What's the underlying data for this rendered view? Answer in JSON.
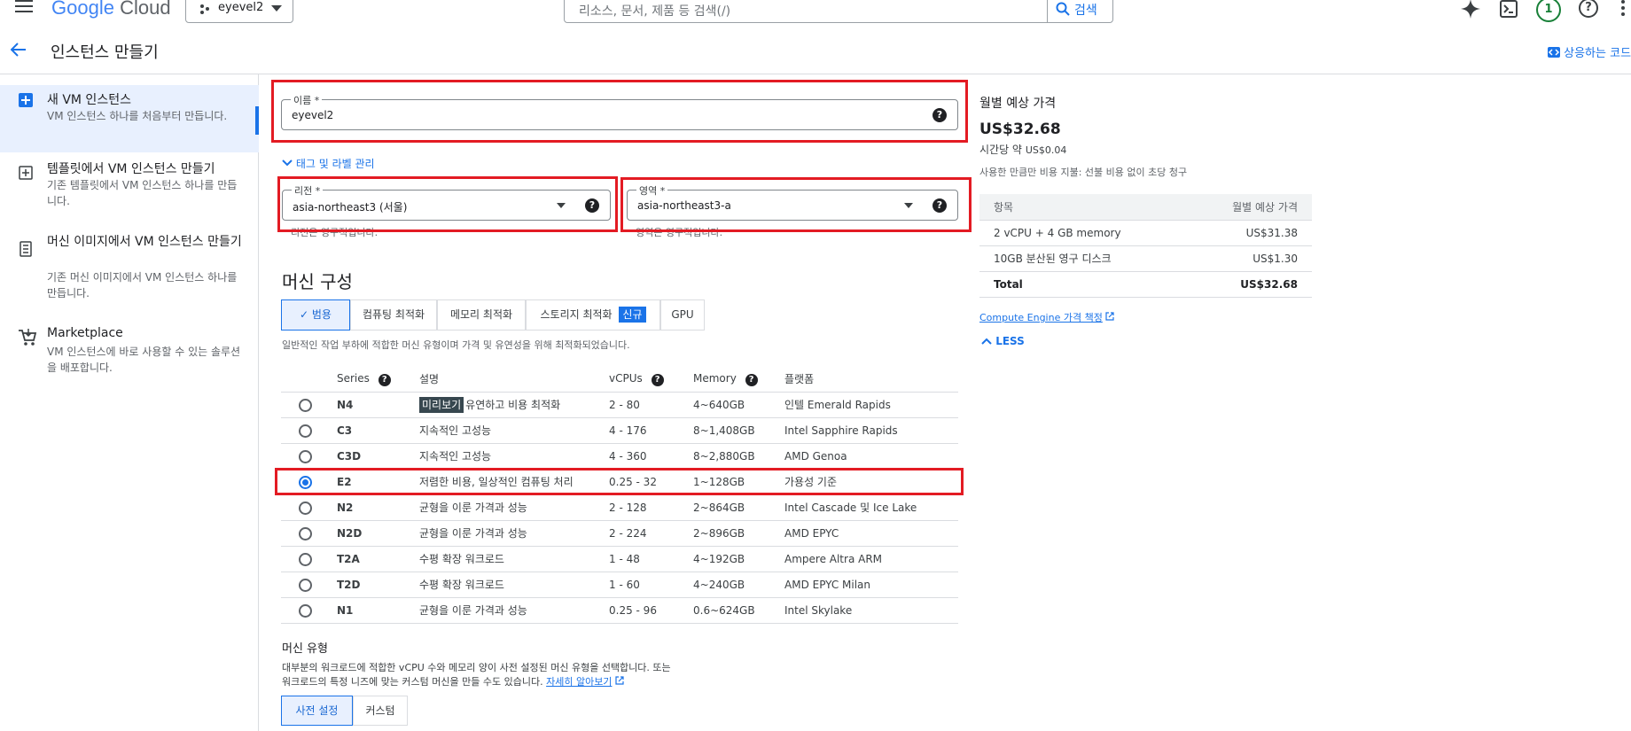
{
  "topbar": {
    "logo_google": "Google",
    "logo_cloud": "Cloud",
    "project": "eyevel2",
    "search_placeholder": "리소스, 문서, 제품 등 검색(/)",
    "search_button": "검색",
    "notification_count": "1"
  },
  "header": {
    "title": "인스턴스 만들기",
    "equivalent_code": "상응하는 코드"
  },
  "sidebar": {
    "items": [
      {
        "title": "새 VM 인스턴스",
        "desc": "VM 인스턴스 하나를 처음부터 만듭니다."
      },
      {
        "title": "템플릿에서 VM 인스턴스 만들기",
        "desc": "기존 템플릿에서 VM 인스턴스 하나를 만듭니다."
      },
      {
        "title": "머신 이미지에서 VM 인스턴스 만들기",
        "desc": "기존 머신 이미지에서 VM 인스턴스 하나를 만듭니다."
      },
      {
        "title": "Marketplace",
        "desc": "VM 인스턴스에 바로 사용할 수 있는 솔루션을 배포합니다."
      }
    ]
  },
  "form": {
    "name_label": "이름 *",
    "name_value": "eyevel2",
    "tags_link": "태그 및 라벨 관리",
    "region_label": "리전 *",
    "region_value": "asia-northeast3 (서울)",
    "region_hint": "리전은 영구적입니다.",
    "zone_label": "영역 *",
    "zone_value": "asia-northeast3-a",
    "zone_hint": "영역은 영구적입니다."
  },
  "machine_config": {
    "heading": "머신 구성",
    "tabs": [
      "범용",
      "컴퓨팅 최적화",
      "메모리 최적화",
      "스토리지 최적화",
      "GPU"
    ],
    "new_badge": "신규",
    "description": "일반적인 작업 부하에 적합한 머신 유형이며 가격 및 유연성을 위해 최적화되었습니다.",
    "columns": [
      "Series",
      "설명",
      "vCPUs",
      "Memory",
      "플랫폼"
    ],
    "preview_badge": "미리보기",
    "rows": [
      {
        "series": "N4",
        "desc": "유연하고 비용 최적화",
        "vcpus": "2 - 80",
        "memory": "4~640GB",
        "platform": "인텔 Emerald Rapids",
        "selected": false
      },
      {
        "series": "C3",
        "desc": "지속적인 고성능",
        "vcpus": "4 - 176",
        "memory": "8~1,408GB",
        "platform": "Intel Sapphire Rapids",
        "selected": false
      },
      {
        "series": "C3D",
        "desc": "지속적인 고성능",
        "vcpus": "4 - 360",
        "memory": "8~2,880GB",
        "platform": "AMD Genoa",
        "selected": false
      },
      {
        "series": "E2",
        "desc": "저렴한 비용, 일상적인 컴퓨팅 처리",
        "vcpus": "0.25 - 32",
        "memory": "1~128GB",
        "platform": "가용성 기준",
        "selected": true
      },
      {
        "series": "N2",
        "desc": "균형을 이룬 가격과 성능",
        "vcpus": "2 - 128",
        "memory": "2~864GB",
        "platform": "Intel Cascade 및 Ice Lake",
        "selected": false
      },
      {
        "series": "N2D",
        "desc": "균형을 이룬 가격과 성능",
        "vcpus": "2 - 224",
        "memory": "2~896GB",
        "platform": "AMD EPYC",
        "selected": false
      },
      {
        "series": "T2A",
        "desc": "수평 확장 워크로드",
        "vcpus": "1 - 48",
        "memory": "4~192GB",
        "platform": "Ampere Altra ARM",
        "selected": false
      },
      {
        "series": "T2D",
        "desc": "수평 확장 워크로드",
        "vcpus": "1 - 60",
        "memory": "4~240GB",
        "platform": "AMD EPYC Milan",
        "selected": false
      },
      {
        "series": "N1",
        "desc": "균형을 이룬 가격과 성능",
        "vcpus": "0.25 - 96",
        "memory": "0.6~624GB",
        "platform": "Intel Skylake",
        "selected": false
      }
    ]
  },
  "machine_type": {
    "heading": "머신 유형",
    "desc_line1": "대부분의 워크로드에 적합한 vCPU 수와 메모리 양이 사전 설정된 머신 유형을 선택합니다. 또는",
    "desc_line2": "워크로드의 특정 니즈에 맞는 커스텀 머신을 만들 수도 있습니다.",
    "learn_more": "자세히 알아보기",
    "preset_tab": "사전 설정",
    "custom_tab": "커스텀"
  },
  "pricing": {
    "heading": "월별 예상 가격",
    "total": "US$32.68",
    "hourly_label": "시간당 약",
    "hourly_value": "US$0.04",
    "note": "사용한 만큼만 비용 지불: 선불 비용 없이 초당 청구",
    "col_item": "항목",
    "col_price": "월별 예상 가격",
    "rows": [
      {
        "item": "2 vCPU + 4 GB memory",
        "price": "US$31.38"
      },
      {
        "item": "10GB 분산된 영구 디스크",
        "price": "US$1.30"
      },
      {
        "item": "Total",
        "price": "US$32.68"
      }
    ],
    "compute_link": "Compute Engine 가격 책정",
    "less": "LESS"
  }
}
